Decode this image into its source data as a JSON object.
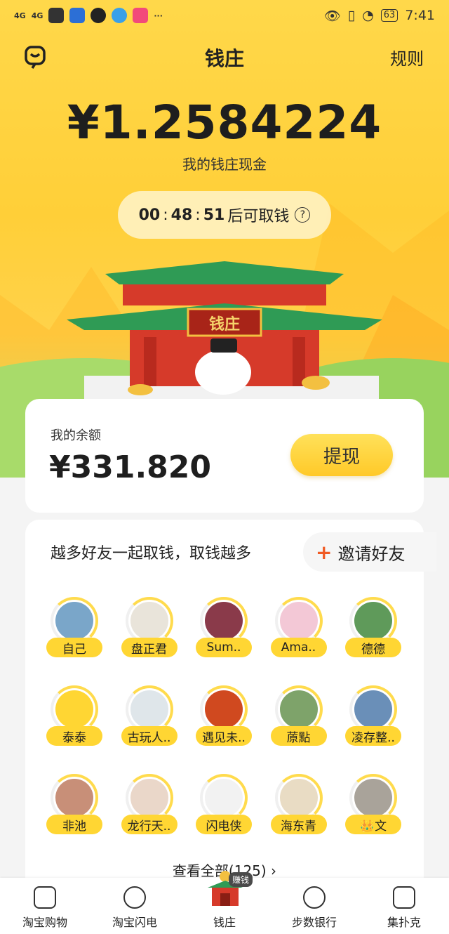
{
  "status_bar": {
    "network1": "4G",
    "network2": "4G",
    "battery": "63",
    "time": "7:41",
    "more": "···"
  },
  "nav": {
    "title": "钱庄",
    "rules_label": "规则"
  },
  "cash": {
    "amount": "¥1.2584224",
    "label": "我的钱庄现金"
  },
  "timer": {
    "hours": "00",
    "minutes": "48",
    "seconds": "51",
    "suffix": "后可取钱",
    "help": "?"
  },
  "temple": {
    "sign": "钱庄"
  },
  "balance": {
    "label": "我的余额",
    "amount": "¥331.820",
    "withdraw_label": "提现"
  },
  "friends": {
    "heading": "越多好友一起取钱，取钱越多",
    "invite_label": "邀请好友",
    "list": [
      {
        "name": "自己",
        "color": "#7aa6c9"
      },
      {
        "name": "盘正君",
        "color": "#e9e4da"
      },
      {
        "name": "Sum..",
        "color": "#8a3a4a"
      },
      {
        "name": "Ama..",
        "color": "#f3c8d6"
      },
      {
        "name": "德德",
        "color": "#5f9a5a"
      },
      {
        "name": "泰泰",
        "color": "#ffd633"
      },
      {
        "name": "古玩人..",
        "color": "#dfe6ea"
      },
      {
        "name": "遇见未..",
        "color": "#d0491f"
      },
      {
        "name": "蒝點",
        "color": "#7ea36a"
      },
      {
        "name": "凌存整..",
        "color": "#6a8fb8"
      },
      {
        "name": "非池",
        "color": "#c88f78"
      },
      {
        "name": "龙行天..",
        "color": "#ead7c9"
      },
      {
        "name": "闪电侠",
        "color": "#f2f2f2"
      },
      {
        "name": "海东青",
        "color": "#e9dcc4"
      },
      {
        "name": "👑文",
        "color": "#a9a39a"
      }
    ],
    "view_all": "查看全部(125) ›"
  },
  "tabbar": {
    "tabs": [
      {
        "label": "淘宝购物"
      },
      {
        "label": "淘宝闪电"
      },
      {
        "label": "钱庄",
        "badge": "赚钱"
      },
      {
        "label": "步数银行"
      },
      {
        "label": "集扑克"
      }
    ]
  }
}
